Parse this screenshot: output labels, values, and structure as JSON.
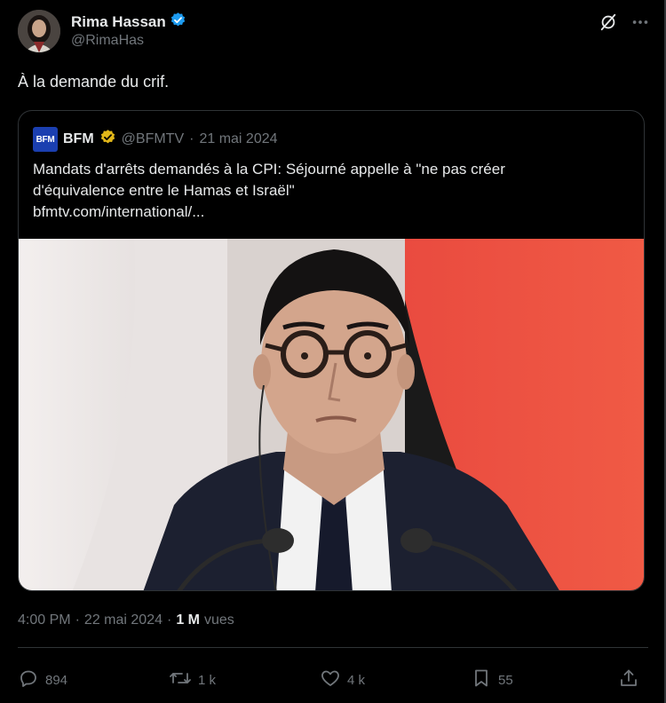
{
  "author": {
    "name": "Rima Hassan",
    "handle": "@RimaHas",
    "verified_color": "#1d9bf0"
  },
  "tweet": {
    "text": "À la demande du crif."
  },
  "quoted": {
    "name": "BFM",
    "logo_text": "BFM",
    "handle": "@BFMTV",
    "separator": "·",
    "date": "21 mai 2024",
    "text_line1": "Mandats d'arrêts demandés à la CPI: Séjourné appelle à \"ne pas créer",
    "text_line2": "d'équivalence entre le Hamas et Israël\"",
    "link": "bfmtv.com/international/...",
    "badge_color": "#e2b719"
  },
  "timestamp": {
    "time": "4:00 PM",
    "sep1": "·",
    "date": "22 mai 2024",
    "sep2": "·",
    "views_count": "1 M",
    "views_label": "vues"
  },
  "actions": {
    "replies": "894",
    "reposts": "1 k",
    "likes": "4 k",
    "bookmarks": "55"
  },
  "icons": {
    "header_grok": "grok-icon",
    "header_more": "more-icon",
    "reply": "reply-icon",
    "repost": "repost-icon",
    "like": "like-icon",
    "bookmark": "bookmark-icon",
    "share": "share-icon"
  }
}
